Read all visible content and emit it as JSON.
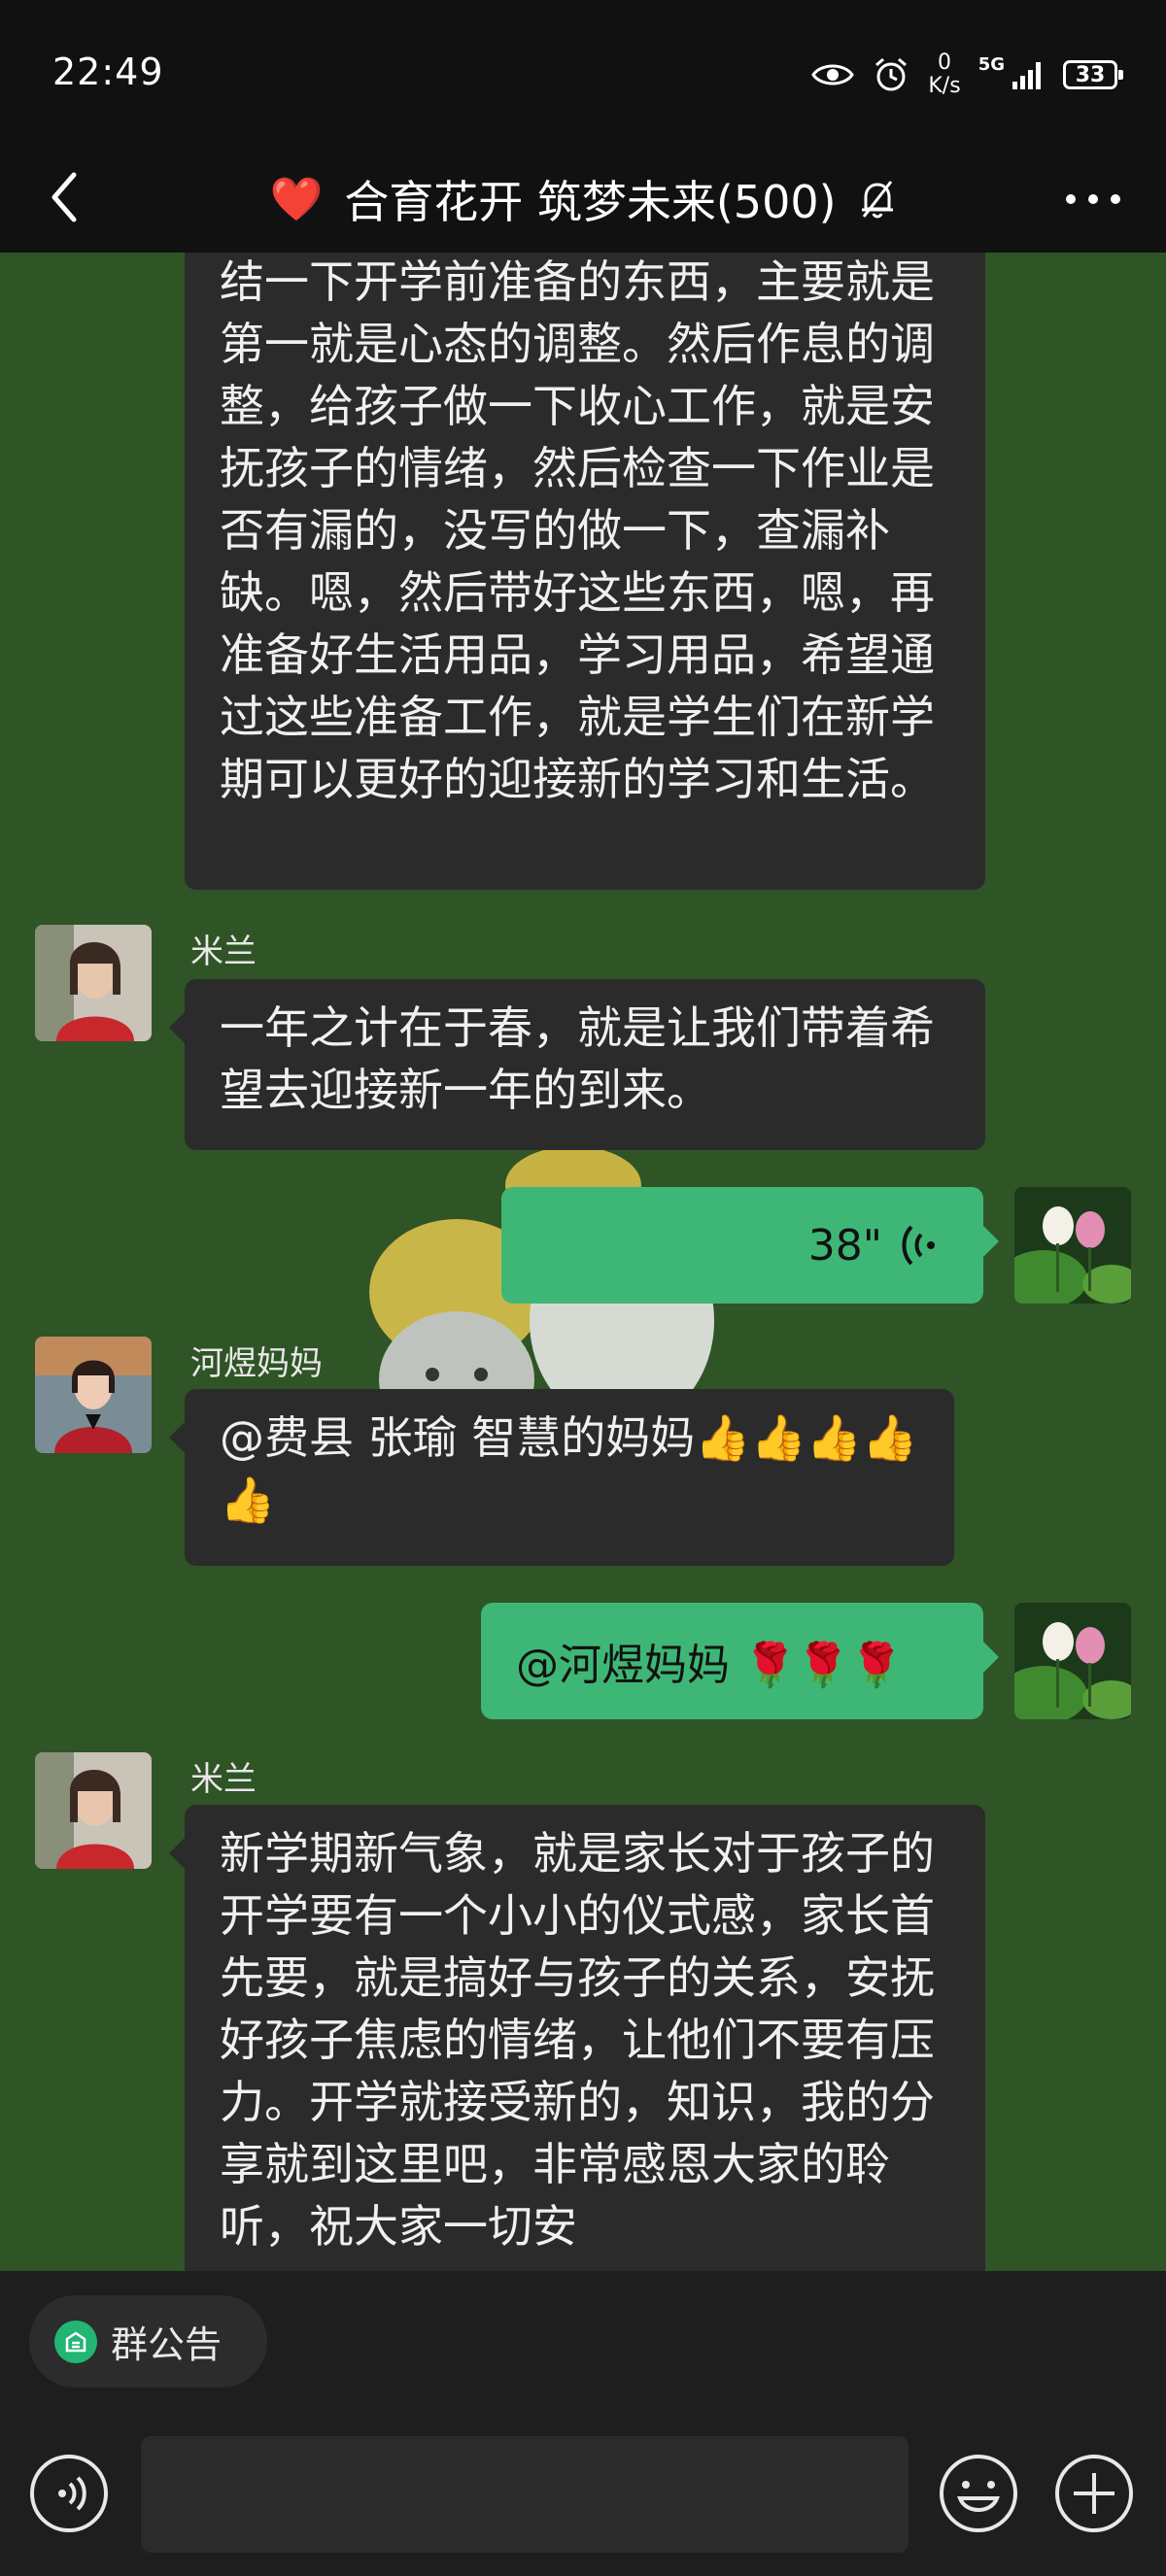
{
  "status": {
    "time": "22:49",
    "net_speed_value": "0",
    "net_speed_unit": "K/s",
    "signal_label": "5G",
    "battery": "33"
  },
  "header": {
    "heart": "❤️",
    "title": "合育花开 筑梦未来(500)"
  },
  "messages": [
    {
      "side": "left",
      "text": "结一下开学前准备的东西，主要就是第一就是心态的调整。然后作息的调整，给孩子做一下收心工作，就是安抚孩子的情绪，然后检查一下作业是否有漏的，没写的做一下，查漏补缺。嗯，然后带好这些东西，嗯，再准备好生活用品，学习用品，希望通过这些准备工作，就是学生们在新学期可以更好的迎接新的学习和生活。"
    },
    {
      "side": "left",
      "sender": "米兰",
      "text": "一年之计在于春，就是让我们带着希望去迎接新一年的到来。"
    },
    {
      "side": "right",
      "type": "voice",
      "duration": "38\""
    },
    {
      "side": "left",
      "sender": "河煜妈妈",
      "text": "@费县 张瑜  智慧的妈妈👍👍👍👍👍"
    },
    {
      "side": "right",
      "text": "@河煜妈妈 🌹🌹🌹"
    },
    {
      "side": "left",
      "sender": "米兰",
      "text": "新学期新气象，就是家长对于孩子的开学要有一个小小的仪式感，家长首先要，就是搞好与孩子的关系，安抚好孩子焦虑的情绪，让他们不要有压力。开学就接受新的，知识，我的分享就到这里吧，非常感恩大家的聆听，祝大家一切安"
    }
  ],
  "bottom": {
    "announcement_label": "群公告"
  },
  "colors": {
    "chat_bg": "#2f5426",
    "bubble_dark": "#2b2b2b",
    "bubble_green": "#3eb776",
    "bar_bg": "#111111"
  }
}
